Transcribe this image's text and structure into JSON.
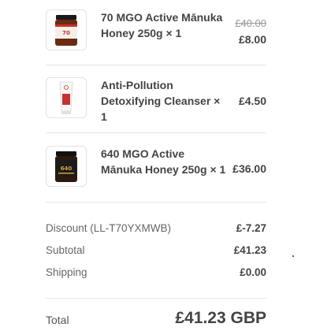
{
  "items": [
    {
      "name": "70 MGO Active Mānuka Honey 250g × 1",
      "original_price": "£40.00",
      "price": "£8.00",
      "image_icon": "honey-jar-icon"
    },
    {
      "name": "Anti-Pollution Detoxifying Cleanser × 1",
      "price": "£4.50",
      "image_icon": "cleanser-tube-icon"
    },
    {
      "name": "640 MGO Active Mānuka Honey 250g × 1",
      "price": "£36.00",
      "image_icon": "honey-jar-dark-icon"
    }
  ],
  "summary": {
    "discount_label": "Discount (LL-T70YXMWB)",
    "discount_value": "£-7.27",
    "subtotal_label": "Subtotal",
    "subtotal_value": "£41.23",
    "shipping_label": "Shipping",
    "shipping_value": "£0.00"
  },
  "total": {
    "label": "Total",
    "value": "£41.23 GBP"
  }
}
